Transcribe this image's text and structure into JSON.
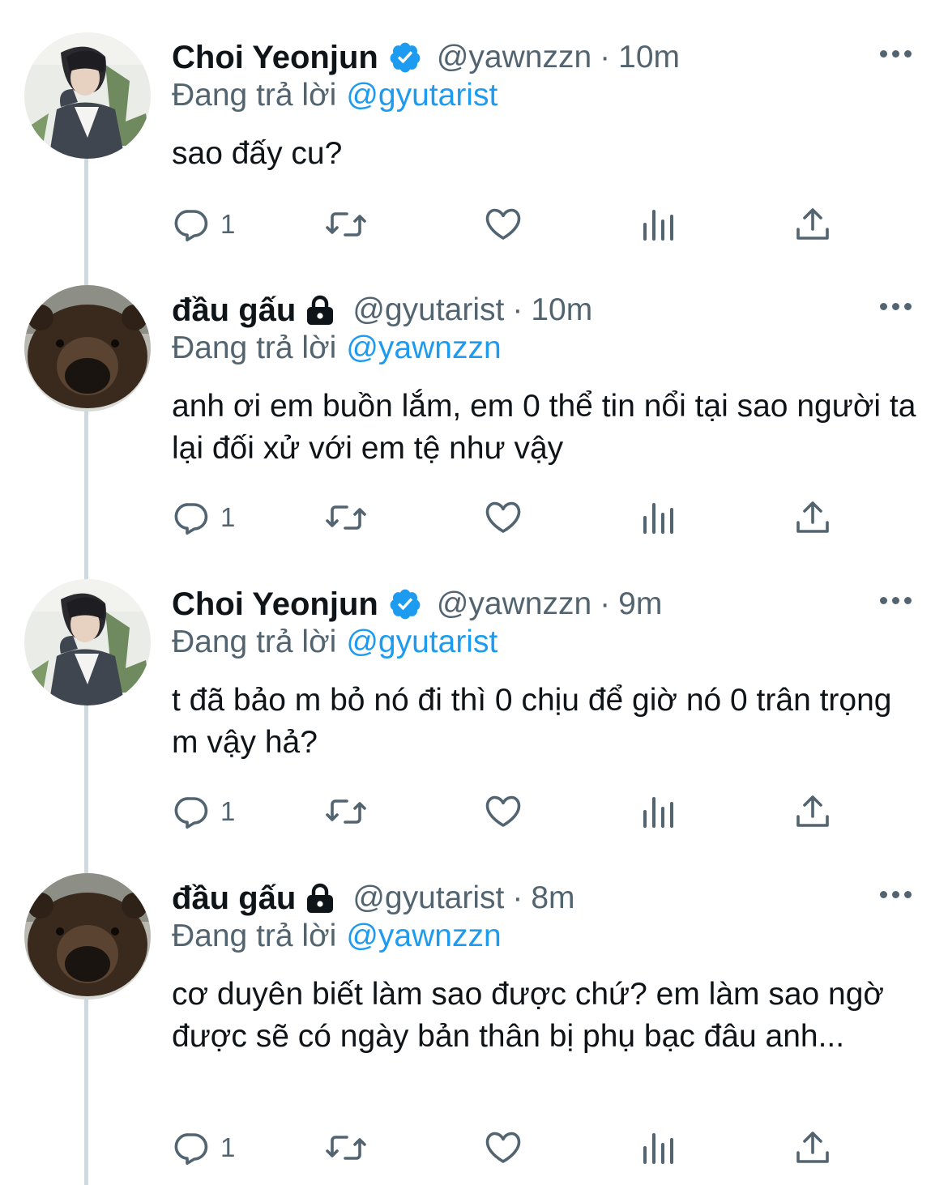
{
  "tweets": [
    {
      "name": "Choi Yeonjun",
      "verified": true,
      "protected": false,
      "handle": "@yawnzzn",
      "separator": "·",
      "time": "10m",
      "reply_prefix": "Đang trả lời",
      "reply_to": "@gyutarist",
      "text": "sao đấy cu?",
      "reply_count": "1",
      "avatar": "person-in-gray-suit-photo"
    },
    {
      "name": "đầu gấu",
      "verified": false,
      "protected": true,
      "handle": "@gyutarist",
      "separator": "·",
      "time": "10m",
      "reply_prefix": "Đang trả lời",
      "reply_to": "@yawnzzn",
      "text": "anh ơi em buồn lắm, em 0 thể tin nổi tại sao người ta lại đối xử với em tệ như vậy",
      "reply_count": "1",
      "avatar": "bear-face-photo"
    },
    {
      "name": "Choi Yeonjun",
      "verified": true,
      "protected": false,
      "handle": "@yawnzzn",
      "separator": "·",
      "time": "9m",
      "reply_prefix": "Đang trả lời",
      "reply_to": "@gyutarist",
      "text": "t đã bảo m bỏ nó đi thì 0 chịu để giờ nó 0 trân trọng m vậy hả?",
      "reply_count": "1",
      "avatar": "person-in-gray-suit-photo"
    },
    {
      "name": "đầu gấu",
      "verified": false,
      "protected": true,
      "handle": "@gyutarist",
      "separator": "·",
      "time": "8m",
      "reply_prefix": "Đang trả lời",
      "reply_to": "@yawnzzn",
      "text": "cơ duyên biết làm sao được chứ? em làm sao ngờ được sẽ có ngày bản thân bị phụ bạc đâu anh...",
      "reply_count": "1",
      "avatar": "bear-face-photo"
    }
  ],
  "icons": {
    "reply": "reply-icon",
    "retweet": "retweet-icon",
    "like": "like-icon",
    "analytics": "analytics-icon",
    "share": "share-icon",
    "more": "more-icon",
    "verified": "verified-badge-icon",
    "lock": "lock-icon"
  },
  "colors": {
    "text": "#0f1419",
    "secondary": "#536471",
    "link": "#1d9bf0",
    "thread_line": "#cfd9de"
  }
}
